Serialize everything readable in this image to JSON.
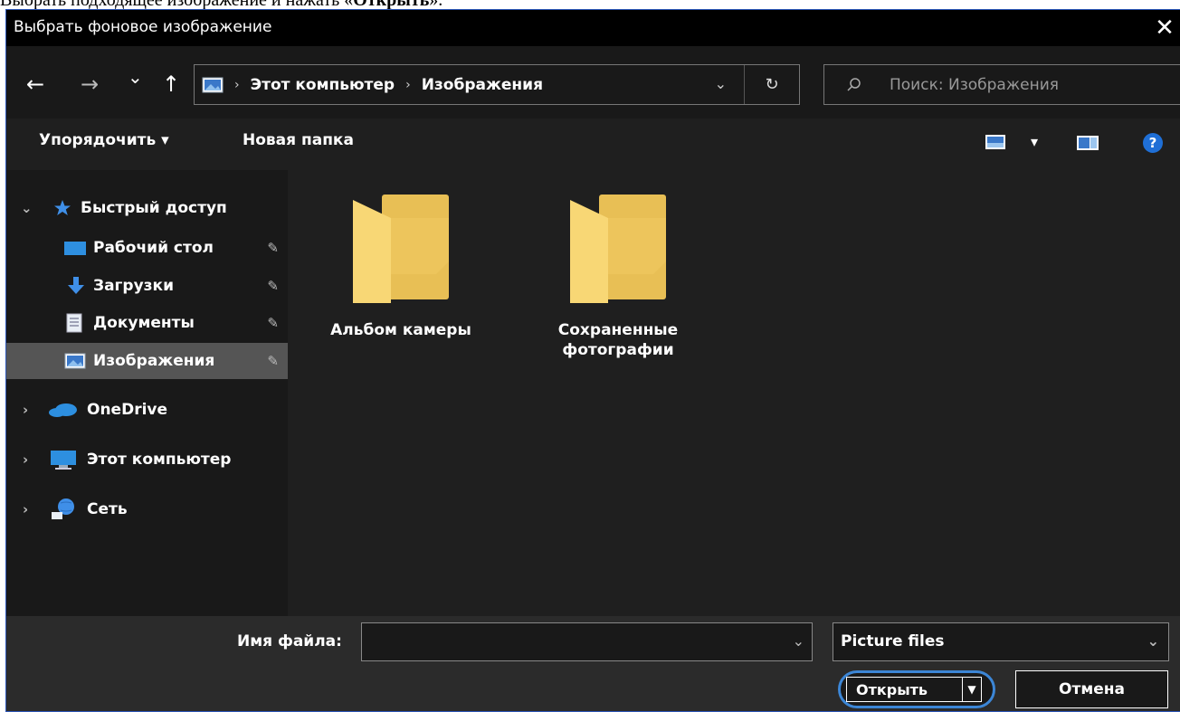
{
  "caption": {
    "text_before": "Выбрать подходящее изображение и нажать «",
    "text_bold": "Открыть",
    "text_after": "»."
  },
  "window": {
    "title": "Выбрать фоновое изображение",
    "close_glyph": "✕"
  },
  "nav": {
    "back_glyph": "←",
    "forward_glyph": "→",
    "recent_glyph": "⌄",
    "up_glyph": "↑",
    "address": {
      "crumbs": [
        "Этот компьютер",
        "Изображения"
      ],
      "separator": "›",
      "dropdown_glyph": "⌄",
      "refresh_glyph": "↻"
    },
    "search": {
      "placeholder": "Поиск: Изображения"
    }
  },
  "toolbar": {
    "organize_label": "Упорядочить ▾",
    "new_folder_label": "Новая папка",
    "view_dropdown_glyph": "▾",
    "help_glyph": "?"
  },
  "sidebar": {
    "quick_access": {
      "label": "Быстрый доступ",
      "items": [
        {
          "label": "Рабочий стол",
          "icon": "desktop-icon"
        },
        {
          "label": "Загрузки",
          "icon": "download-icon"
        },
        {
          "label": "Документы",
          "icon": "documents-icon"
        },
        {
          "label": "Изображения",
          "icon": "pictures-icon",
          "selected": true
        }
      ]
    },
    "onedrive": {
      "label": "OneDrive"
    },
    "this_pc": {
      "label": "Этот компьютер"
    },
    "network": {
      "label": "Сеть"
    },
    "pin_glyph": "📌"
  },
  "main": {
    "folders": [
      {
        "label_line1": "Альбом камеры",
        "label_line2": ""
      },
      {
        "label_line1": "Сохраненные",
        "label_line2": "фотографии"
      }
    ]
  },
  "bottom": {
    "filename_label": "Имя файла:",
    "filename_value": "",
    "filetype_value": "Picture files",
    "open_label": "Открыть",
    "cancel_label": "Отмена"
  },
  "colors": {
    "accent": "#3c86d6",
    "folder": "#f8d775",
    "folder_dark": "#e8bf55",
    "background": "#191919"
  }
}
